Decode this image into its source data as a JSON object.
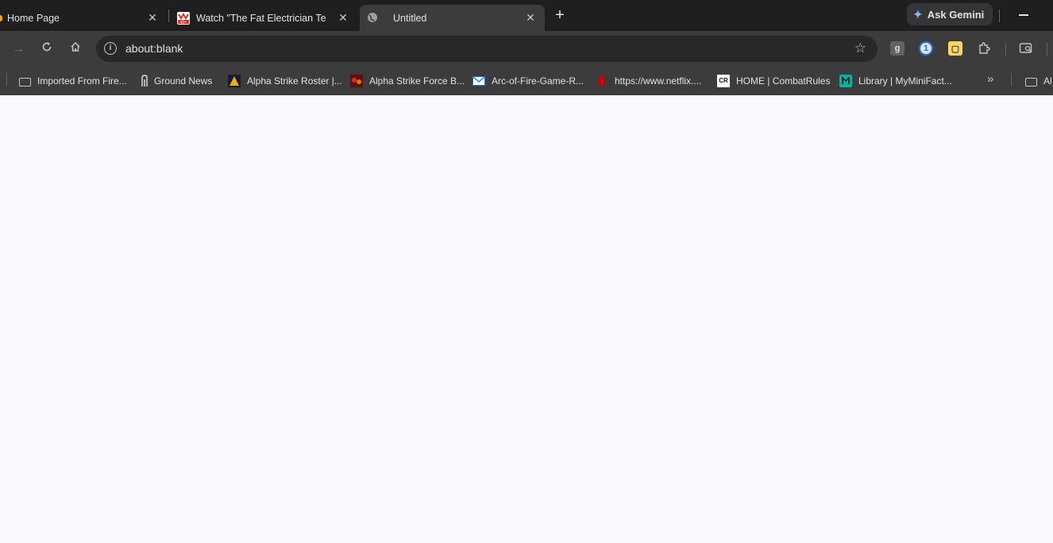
{
  "tabs": [
    {
      "title": "Home Page",
      "active": false
    },
    {
      "title": "Watch \"The Fat Electrician Tells",
      "active": false
    },
    {
      "title": "Untitled",
      "active": true
    }
  ],
  "new_tab_label": "+",
  "gemini_label": "Ask Gemini",
  "omnibox": {
    "url": "about:blank"
  },
  "extensions": [
    "google-ext-icon",
    "password-manager-icon",
    "reader-ext-icon",
    "extensions-icon",
    "side-panel-icon"
  ],
  "bookmarks": [
    {
      "label": "Imported From Fire...",
      "icon": "folder-icon"
    },
    {
      "label": "Ground News",
      "icon": "ground-news-icon"
    },
    {
      "label": "Alpha Strike Roster |...",
      "icon": "alpha-strike-icon"
    },
    {
      "label": "Alpha Strike Force B...",
      "icon": "force-builder-icon"
    },
    {
      "label": "Arc-of-Fire-Game-R...",
      "icon": "mail-icon"
    },
    {
      "label": "https://www.netflix....",
      "icon": "netflix-icon"
    },
    {
      "label": "HOME | CombatRules",
      "icon": "combatrules-icon"
    },
    {
      "label": "Library | MyMiniFact...",
      "icon": "myminifactory-icon"
    },
    {
      "label": "Al",
      "icon": "folder-icon"
    }
  ],
  "colors": {
    "tabstrip": "#1f1f1f",
    "toolbar": "#3c3c3c",
    "page": "#f8fafd"
  }
}
